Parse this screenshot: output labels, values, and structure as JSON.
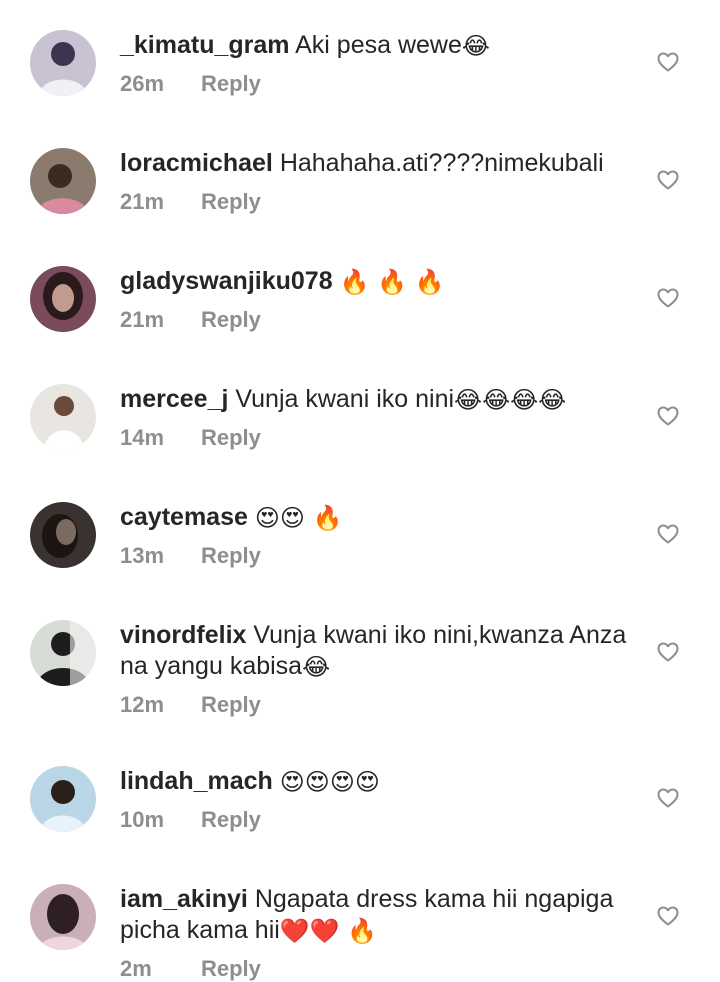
{
  "comments": [
    {
      "username": "_kimatu_gram",
      "text": "Aki pesa wewe",
      "emojis": "😂",
      "time": "26m",
      "reply_label": "Reply",
      "avatar_colors": [
        "#c9c2d2",
        "#f2f0f4",
        "#3b3550"
      ]
    },
    {
      "username": "loracmichael",
      "text": "Hahahaha.ati????nimekubali",
      "emojis": "",
      "time": "21m",
      "reply_label": "Reply",
      "avatar_colors": [
        "#8a7b6e",
        "#d98aa0",
        "#3a2c22"
      ]
    },
    {
      "username": "gladyswanjiku078",
      "text": "",
      "emojis": "🔥 🔥 🔥",
      "time": "21m",
      "reply_label": "Reply",
      "avatar_colors": [
        "#7a4b5a",
        "#c29a8e",
        "#2a1a1e"
      ]
    },
    {
      "username": "mercee_j",
      "text": "Vunja kwani iko nini",
      "emojis": "😂😂😂😂",
      "time": "14m",
      "reply_label": "Reply",
      "avatar_colors": [
        "#e9e6e1",
        "#ffffff",
        "#6b4a3a"
      ]
    },
    {
      "username": "caytemase",
      "text": "",
      "emojis": "😍😍 🔥",
      "time": "13m",
      "reply_label": "Reply",
      "avatar_colors": [
        "#3a3230",
        "#7a6a62",
        "#1b1512"
      ]
    },
    {
      "username": "vinordfelix",
      "text": "Vunja kwani iko nini,kwanza Anza na yangu kabisa",
      "emojis": "😂",
      "time": "12m",
      "reply_label": "Reply",
      "avatar_colors": [
        "#d8dcd6",
        "#f4f4f2",
        "#1e1c1c"
      ]
    },
    {
      "username": "lindah_mach",
      "text": "",
      "emojis": "😍😍😍😍",
      "time": "10m",
      "reply_label": "Reply",
      "avatar_colors": [
        "#b9d6e6",
        "#e8f2f8",
        "#2b1f1c"
      ]
    },
    {
      "username": "iam_akinyi",
      "text": "Ngapata dress kama hii ngapiga picha kama hii",
      "emojis": "❤️❤️ 🔥",
      "time": "2m",
      "reply_label": "Reply",
      "avatar_colors": [
        "#c9b0b7",
        "#efd6dc",
        "#2e1f22"
      ]
    }
  ],
  "icons": {
    "like": "heart-outline",
    "avatar": "profile-photo"
  },
  "colors": {
    "username": "#262626",
    "text": "#262626",
    "meta": "#8e8e8e",
    "heart": "#8e8e8e",
    "background": "#ffffff"
  }
}
